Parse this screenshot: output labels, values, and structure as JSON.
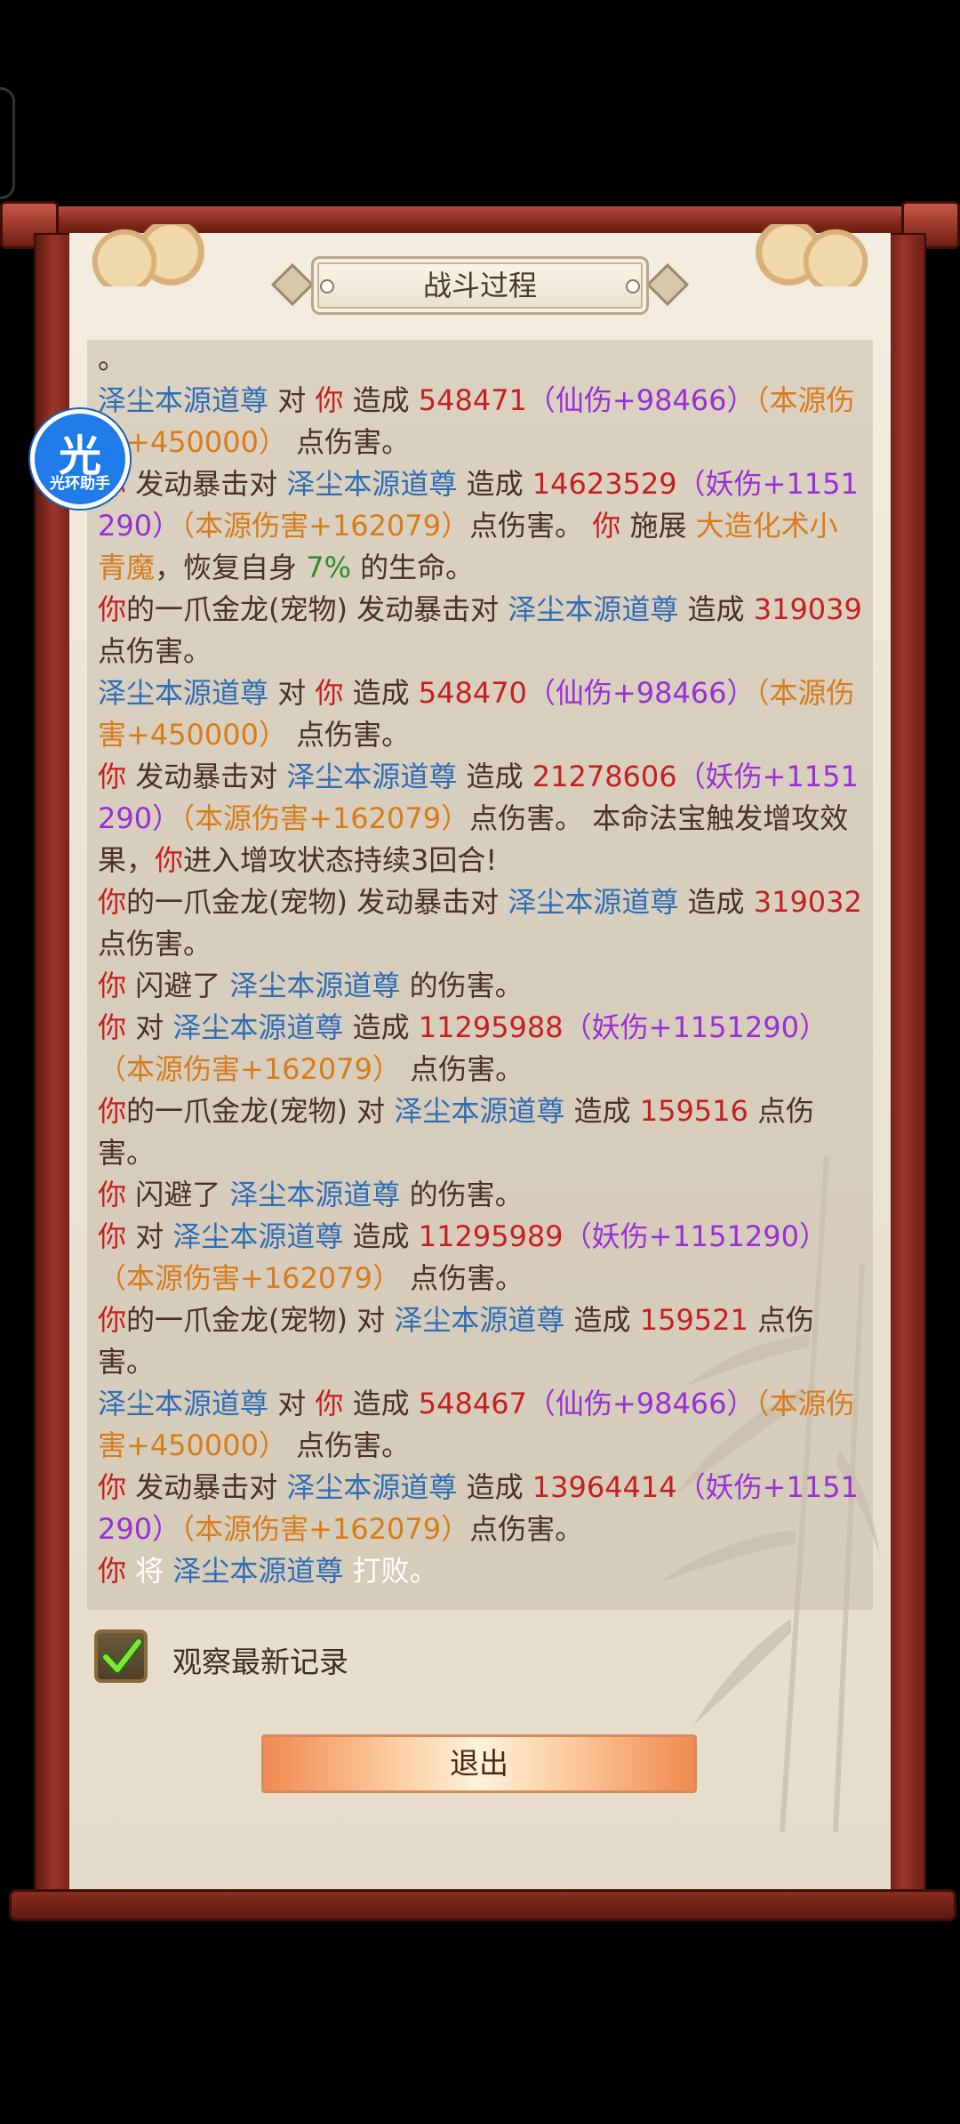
{
  "title": "战斗过程",
  "watermark": {
    "char": "光",
    "text": "光环助手"
  },
  "log_lines": [
    [
      {
        "t": "。",
        "c": "plain"
      }
    ],
    [
      {
        "t": "泽尘本源道尊",
        "c": "boss"
      },
      {
        "t": " 对 ",
        "c": "plain"
      },
      {
        "t": "你",
        "c": "you"
      },
      {
        "t": " 造成 ",
        "c": "plain"
      },
      {
        "t": "548471",
        "c": "num"
      },
      {
        "t": "（仙伤+98466）",
        "c": "xian"
      },
      {
        "t": "（本源伤害+450000）",
        "c": "ben"
      },
      {
        "t": " 点伤害。",
        "c": "plain"
      }
    ],
    [
      {
        "t": "你",
        "c": "you"
      },
      {
        "t": " 发动暴击对 ",
        "c": "plain"
      },
      {
        "t": "泽尘本源道尊",
        "c": "boss"
      },
      {
        "t": " 造成 ",
        "c": "plain"
      },
      {
        "t": "14623529",
        "c": "num"
      },
      {
        "t": "（妖伤+1151290）",
        "c": "yao"
      },
      {
        "t": "（本源伤害+162079）",
        "c": "ben"
      },
      {
        "t": "点伤害。 ",
        "c": "plain"
      },
      {
        "t": "你",
        "c": "you"
      },
      {
        "t": " 施展 ",
        "c": "plain"
      },
      {
        "t": "大造化术小青魔",
        "c": "skill"
      },
      {
        "t": "，恢复自身 ",
        "c": "plain"
      },
      {
        "t": "7%",
        "c": "green"
      },
      {
        "t": " 的生命。",
        "c": "plain"
      }
    ],
    [
      {
        "t": "你",
        "c": "you"
      },
      {
        "t": "的一爪金龙(宠物) 发动暴击对 ",
        "c": "plain"
      },
      {
        "t": "泽尘本源道尊",
        "c": "boss"
      },
      {
        "t": " 造成 ",
        "c": "plain"
      },
      {
        "t": "319039",
        "c": "num"
      },
      {
        "t": " 点伤害。",
        "c": "plain"
      }
    ],
    [
      {
        "t": "泽尘本源道尊",
        "c": "boss"
      },
      {
        "t": " 对 ",
        "c": "plain"
      },
      {
        "t": "你",
        "c": "you"
      },
      {
        "t": " 造成 ",
        "c": "plain"
      },
      {
        "t": "548470",
        "c": "num"
      },
      {
        "t": "（仙伤+98466）",
        "c": "xian"
      },
      {
        "t": "（本源伤害+450000）",
        "c": "ben"
      },
      {
        "t": " 点伤害。",
        "c": "plain"
      }
    ],
    [
      {
        "t": "你",
        "c": "you"
      },
      {
        "t": " 发动暴击对 ",
        "c": "plain"
      },
      {
        "t": "泽尘本源道尊",
        "c": "boss"
      },
      {
        "t": " 造成 ",
        "c": "plain"
      },
      {
        "t": "21278606",
        "c": "num"
      },
      {
        "t": "（妖伤+1151290）",
        "c": "yao"
      },
      {
        "t": "（本源伤害+162079）",
        "c": "ben"
      },
      {
        "t": "点伤害。 本命法宝触发增攻效果，",
        "c": "plain"
      },
      {
        "t": "你",
        "c": "you"
      },
      {
        "t": "进入增攻状态持续3回合!",
        "c": "plain"
      }
    ],
    [
      {
        "t": "你",
        "c": "you"
      },
      {
        "t": "的一爪金龙(宠物) 发动暴击对 ",
        "c": "plain"
      },
      {
        "t": "泽尘本源道尊",
        "c": "boss"
      },
      {
        "t": " 造成 ",
        "c": "plain"
      },
      {
        "t": "319032",
        "c": "num"
      },
      {
        "t": " 点伤害。",
        "c": "plain"
      }
    ],
    [
      {
        "t": "你",
        "c": "you"
      },
      {
        "t": " 闪避了 ",
        "c": "plain"
      },
      {
        "t": "泽尘本源道尊",
        "c": "boss"
      },
      {
        "t": " 的伤害。",
        "c": "plain"
      }
    ],
    [
      {
        "t": "你",
        "c": "you"
      },
      {
        "t": " 对 ",
        "c": "plain"
      },
      {
        "t": "泽尘本源道尊",
        "c": "boss"
      },
      {
        "t": " 造成 ",
        "c": "plain"
      },
      {
        "t": "11295988",
        "c": "num"
      },
      {
        "t": "（妖伤+1151290）",
        "c": "yao"
      },
      {
        "t": "（本源伤害+162079）",
        "c": "ben"
      },
      {
        "t": " 点伤害。",
        "c": "plain"
      }
    ],
    [
      {
        "t": "你",
        "c": "you"
      },
      {
        "t": "的一爪金龙(宠物) 对 ",
        "c": "plain"
      },
      {
        "t": "泽尘本源道尊",
        "c": "boss"
      },
      {
        "t": " 造成 ",
        "c": "plain"
      },
      {
        "t": "159516",
        "c": "num"
      },
      {
        "t": " 点伤害。",
        "c": "plain"
      }
    ],
    [
      {
        "t": "你",
        "c": "you"
      },
      {
        "t": " 闪避了 ",
        "c": "plain"
      },
      {
        "t": "泽尘本源道尊",
        "c": "boss"
      },
      {
        "t": " 的伤害。",
        "c": "plain"
      }
    ],
    [
      {
        "t": "你",
        "c": "you"
      },
      {
        "t": " 对 ",
        "c": "plain"
      },
      {
        "t": "泽尘本源道尊",
        "c": "boss"
      },
      {
        "t": " 造成 ",
        "c": "plain"
      },
      {
        "t": "11295989",
        "c": "num"
      },
      {
        "t": "（妖伤+1151290）",
        "c": "yao"
      },
      {
        "t": "（本源伤害+162079）",
        "c": "ben"
      },
      {
        "t": " 点伤害。",
        "c": "plain"
      }
    ],
    [
      {
        "t": "你",
        "c": "you"
      },
      {
        "t": "的一爪金龙(宠物) 对 ",
        "c": "plain"
      },
      {
        "t": "泽尘本源道尊",
        "c": "boss"
      },
      {
        "t": " 造成 ",
        "c": "plain"
      },
      {
        "t": "159521",
        "c": "num"
      },
      {
        "t": " 点伤害。",
        "c": "plain"
      }
    ],
    [
      {
        "t": "泽尘本源道尊",
        "c": "boss"
      },
      {
        "t": " 对 ",
        "c": "plain"
      },
      {
        "t": "你",
        "c": "you"
      },
      {
        "t": " 造成 ",
        "c": "plain"
      },
      {
        "t": "548467",
        "c": "num"
      },
      {
        "t": "（仙伤+98466）",
        "c": "xian"
      },
      {
        "t": "（本源伤害+450000）",
        "c": "ben"
      },
      {
        "t": " 点伤害。",
        "c": "plain"
      }
    ],
    [
      {
        "t": "你",
        "c": "you"
      },
      {
        "t": " 发动暴击对 ",
        "c": "plain"
      },
      {
        "t": "泽尘本源道尊",
        "c": "boss"
      },
      {
        "t": " 造成 ",
        "c": "plain"
      },
      {
        "t": "13964414",
        "c": "num"
      },
      {
        "t": "（妖伤+1151290）",
        "c": "yao"
      },
      {
        "t": "（本源伤害+162079）",
        "c": "ben"
      },
      {
        "t": "点伤害。",
        "c": "plain"
      }
    ],
    [
      {
        "t": "你",
        "c": "you"
      },
      {
        "t": " 将 ",
        "c": "white"
      },
      {
        "t": "泽尘本源道尊",
        "c": "boss"
      },
      {
        "t": " 打败。",
        "c": "white"
      }
    ]
  ],
  "checkbox": {
    "label": "观察最新记录",
    "checked": true
  },
  "exit_label": "退出",
  "colors": {
    "boss": "#2f6db5",
    "you": "#c52020",
    "number": "#c52020",
    "xian_damage": "#9a2fd6",
    "yao_damage": "#9a2fd6",
    "benyuan_damage": "#d97c1a",
    "skill": "#d97c1a",
    "heal_percent": "#2e8b2e",
    "plain_text": "#4b3222"
  },
  "icons": {
    "watermark": "guanghuan-logo-icon",
    "checkbox_check": "check-icon",
    "decoration": "bamboo-icon"
  }
}
